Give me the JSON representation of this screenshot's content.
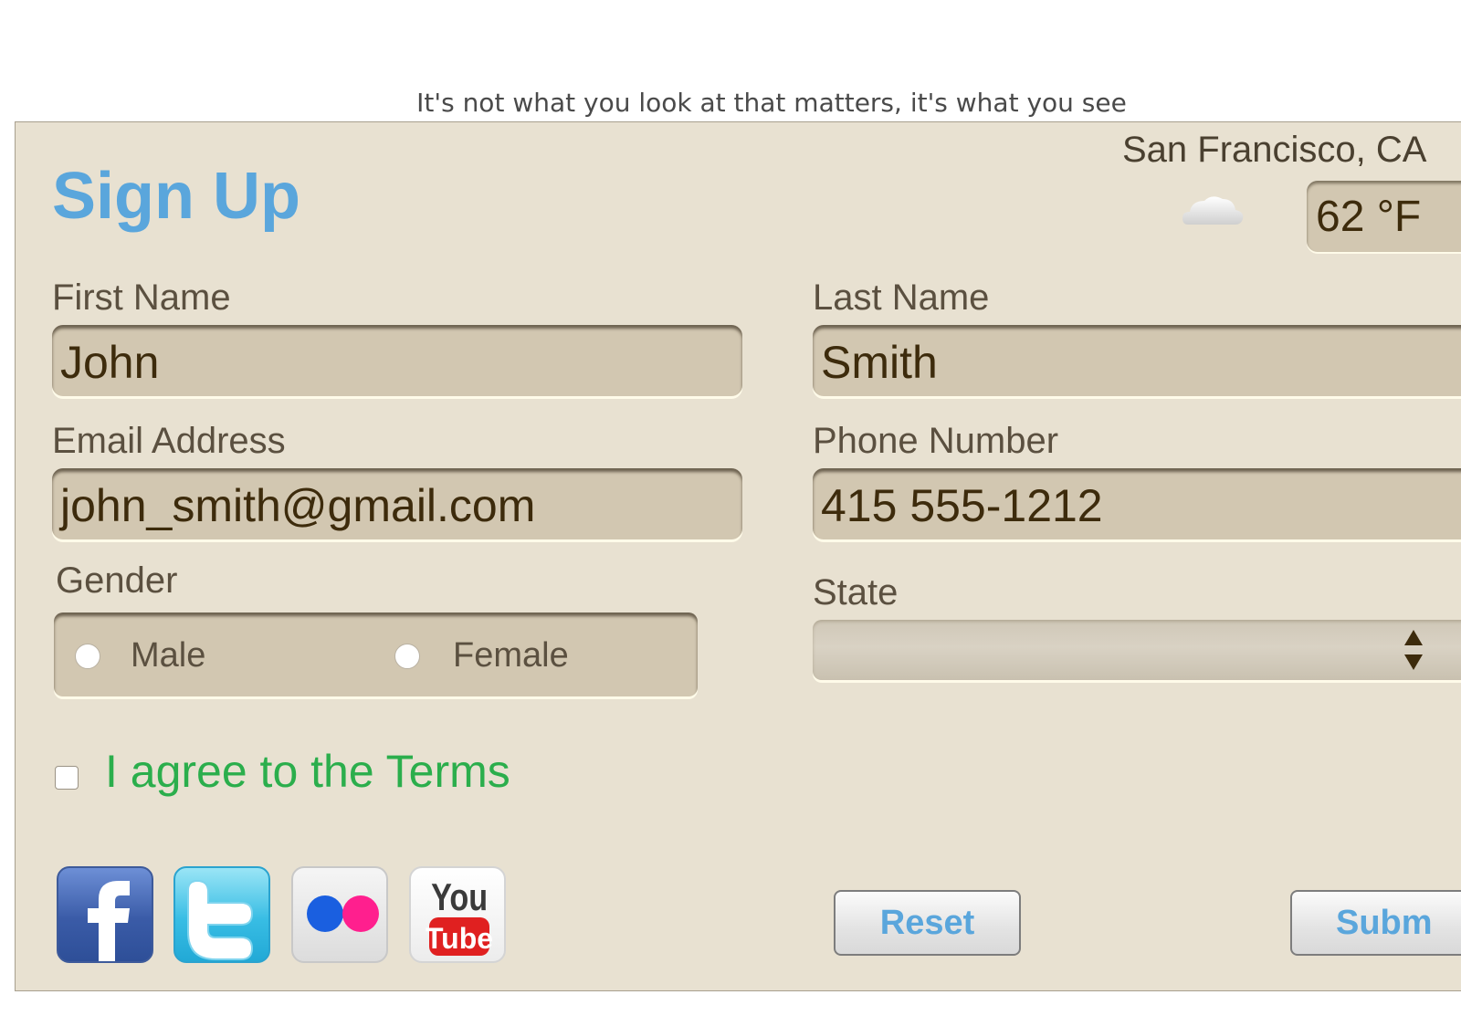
{
  "tagline": "It's not what you look at that matters, it's what you see",
  "form": {
    "title": "Sign Up",
    "first_name": {
      "label": "First Name",
      "value": "John"
    },
    "last_name": {
      "label": "Last Name",
      "value": "Smith"
    },
    "email": {
      "label": "Email Address",
      "value": "john_smith@gmail.com"
    },
    "phone": {
      "label": "Phone Number",
      "value": "415 555-1212"
    },
    "gender": {
      "label": "Gender",
      "options": [
        "Male",
        "Female"
      ]
    },
    "state": {
      "label": "State",
      "value": ""
    },
    "terms": {
      "label": "I agree to the Terms",
      "checked": false
    },
    "buttons": {
      "reset": "Reset",
      "submit": "Subm"
    }
  },
  "weather": {
    "location": "San Francisco, CA",
    "temperature": "62 °F",
    "condition_icon": "cloud-icon"
  },
  "social": [
    "facebook-icon",
    "twitter-icon",
    "flickr-icon",
    "youtube-icon"
  ],
  "colors": {
    "accent": "#5aa6dc",
    "terms": "#2bae4c",
    "panel": "#e8e1d1",
    "field": "#d2c7b1"
  }
}
